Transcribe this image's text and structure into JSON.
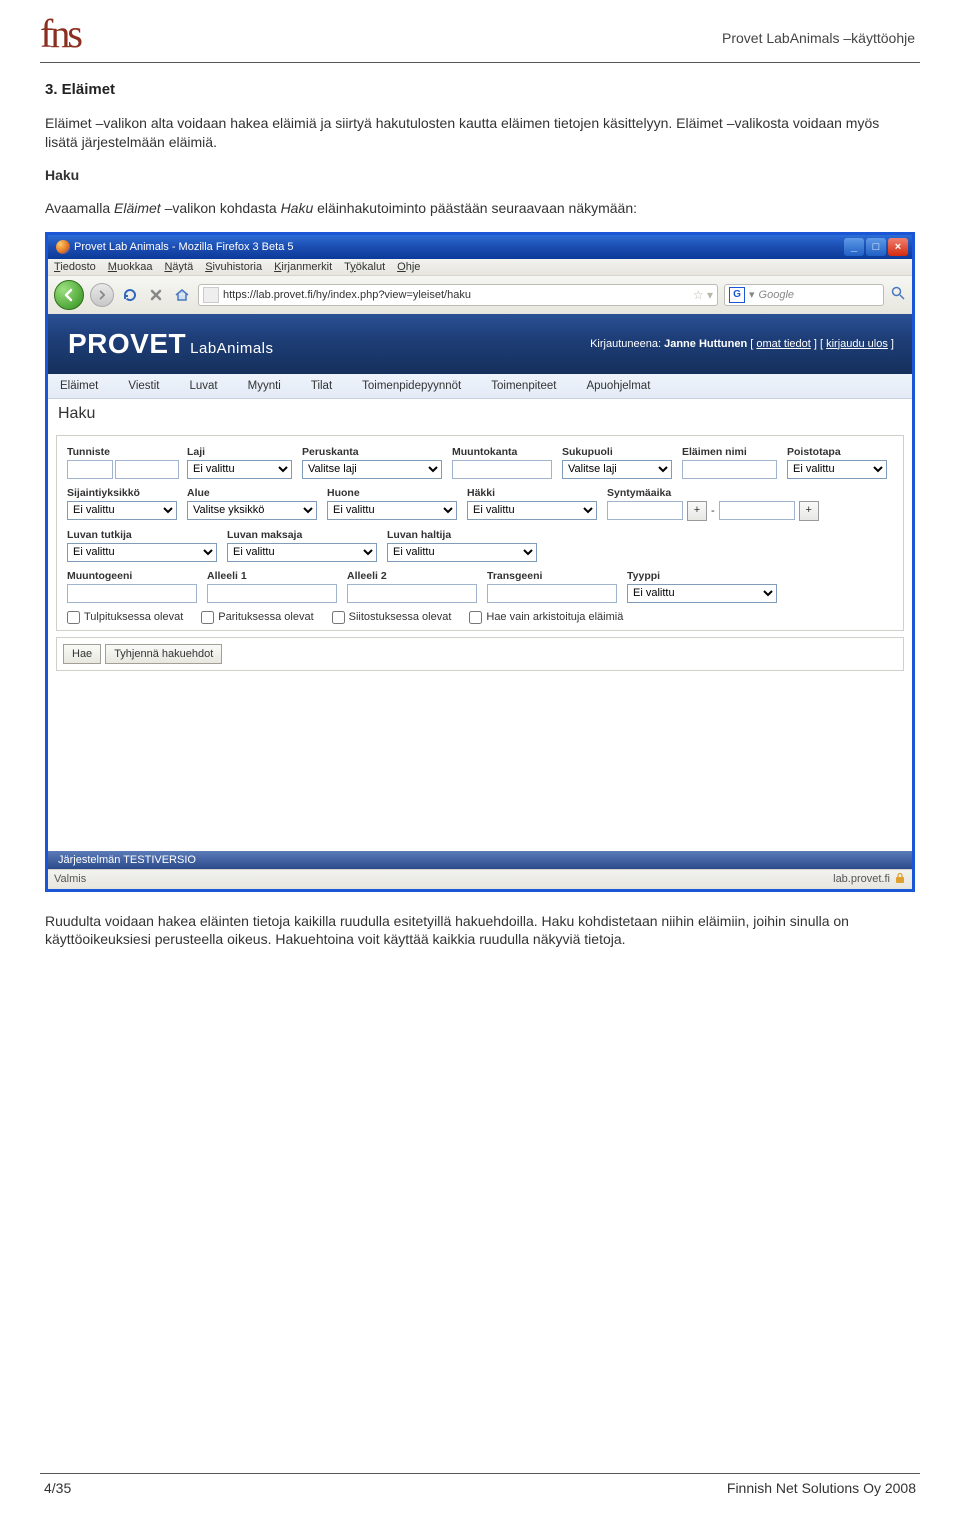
{
  "doc": {
    "logo": "fns",
    "header_title": "Provet LabAnimals –käyttöohje",
    "section_heading": "3. Eläimet",
    "intro_para": "Eläimet –valikon alta voidaan hakea eläimiä ja siirtyä hakutulosten kautta eläimen tietojen käsittelyyn. Eläimet –valikosta voidaan myös lisätä järjestelmään eläimiä.",
    "haku_heading": "Haku",
    "haku_para_pre": "Avaamalla ",
    "haku_para_em1": "Eläimet",
    "haku_para_mid1": " –valikon kohdasta ",
    "haku_para_em2": "Haku",
    "haku_para_post": " eläinhakutoiminto päästään seuraavaan näkymään:",
    "outro_para": "Ruudulta voidaan hakea eläinten tietoja kaikilla ruudulla esitetyillä hakuehdoilla. Haku kohdistetaan niihin eläimiin, joihin sinulla on käyttöoikeuksiesi perusteella oikeus. Hakuehtoina voit käyttää kaikkia ruudulla näkyviä tietoja.",
    "footer_left": "4/35",
    "footer_right": "Finnish Net Solutions Oy 2008"
  },
  "browser": {
    "title": "Provet Lab Animals - Mozilla Firefox 3 Beta 5",
    "menu": [
      "Tiedosto",
      "Muokkaa",
      "Näytä",
      "Sivuhistoria",
      "Kirjanmerkit",
      "Työkalut",
      "Ohje"
    ],
    "url": "https://lab.provet.fi/hy/index.php?view=yleiset/haku",
    "search_placeholder": "Google",
    "status_left": "Valmis",
    "status_right": "lab.provet.fi"
  },
  "app": {
    "brand": "PROVET",
    "brand_sub": "LabAnimals",
    "login_prefix": "Kirjautuneena: ",
    "login_name": "Janne Huttunen",
    "login_link1": "omat tiedot",
    "login_link2": "kirjaudu ulos",
    "nav": [
      "Eläimet",
      "Viestit",
      "Luvat",
      "Myynti",
      "Tilat",
      "Toimenpidepyynnöt",
      "Toimenpiteet",
      "Apuohjelmat"
    ],
    "page_title": "Haku",
    "form": {
      "tunniste": "Tunniste",
      "laji": "Laji",
      "laji_val": "Ei valittu",
      "peruskanta": "Peruskanta",
      "peruskanta_val": "Valitse laji",
      "muuntokanta": "Muuntokanta",
      "sukupuoli": "Sukupuoli",
      "sukupuoli_val": "Valitse laji",
      "elaimen_nimi": "Eläimen nimi",
      "poistotapa": "Poistotapa",
      "poistotapa_val": "Ei valittu",
      "sijaintiyksikko": "Sijaintiyksikkö",
      "sij_val": "Ei valittu",
      "alue": "Alue",
      "alue_val": "Valitse yksikkö",
      "huone": "Huone",
      "huone_val": "Ei valittu",
      "hakki": "Häkki",
      "hakki_val": "Ei valittu",
      "syntymaaika": "Syntymäaika",
      "luvan_tutkija": "Luvan tutkija",
      "lt_val": "Ei valittu",
      "luvan_maksaja": "Luvan maksaja",
      "lm_val": "Ei valittu",
      "luvan_haltija": "Luvan haltija",
      "lh_val": "Ei valittu",
      "muuntogeeni": "Muuntogeeni",
      "alleeli1": "Alleeli 1",
      "alleeli2": "Alleeli 2",
      "transgeeni": "Transgeeni",
      "tyyppi": "Tyyppi",
      "tyyppi_val": "Ei valittu",
      "chk1": "Tulpituksessa olevat",
      "chk2": "Parituksessa olevat",
      "chk3": "Siitostuksessa olevat",
      "chk4": "Hae vain arkistoituja eläimiä",
      "btn_hae": "Hae",
      "btn_tyhjenna": "Tyhjennä hakuehdot",
      "footer_bar": "Järjestelmän TESTIVERSIO"
    }
  }
}
